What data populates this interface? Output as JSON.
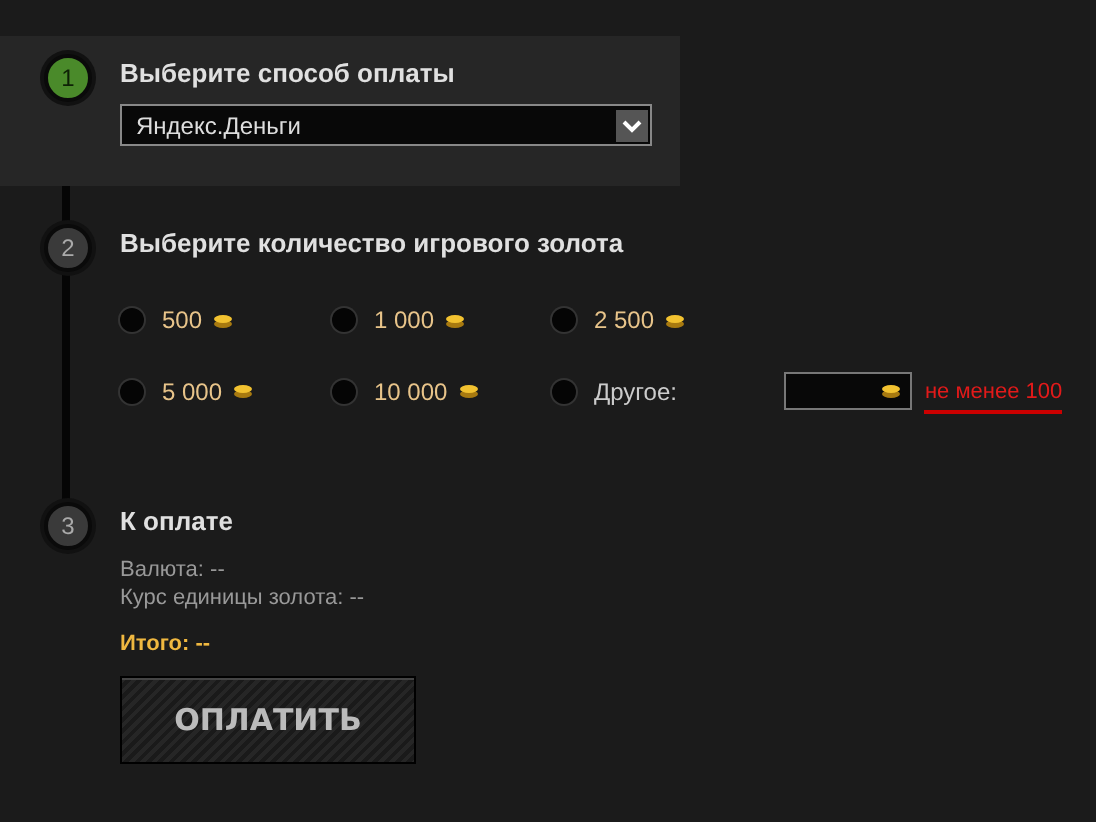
{
  "steps": [
    {
      "kind": "payment_method",
      "number": "1",
      "active": true,
      "title": "Выберите способ оплаты",
      "select": {
        "value": "Яндекс.Деньги"
      }
    },
    {
      "kind": "gold_amount",
      "number": "2",
      "active": false,
      "title": "Выберите количество игрового золота",
      "options": [
        {
          "label": "500",
          "selected": false
        },
        {
          "label": "1 000",
          "selected": false
        },
        {
          "label": "2 500",
          "selected": false
        },
        {
          "label": "5 000",
          "selected": false
        },
        {
          "label": "10 000",
          "selected": false
        }
      ],
      "other": {
        "label": "Другое:",
        "selected": false,
        "hint": "не менее 100"
      }
    },
    {
      "kind": "summary",
      "number": "3",
      "active": false,
      "title": "К оплате",
      "lines": [
        "Валюта: --",
        "Курс единицы золота: --"
      ],
      "total": "Итого: --",
      "button": "ОПЛАТИТЬ"
    }
  ]
}
